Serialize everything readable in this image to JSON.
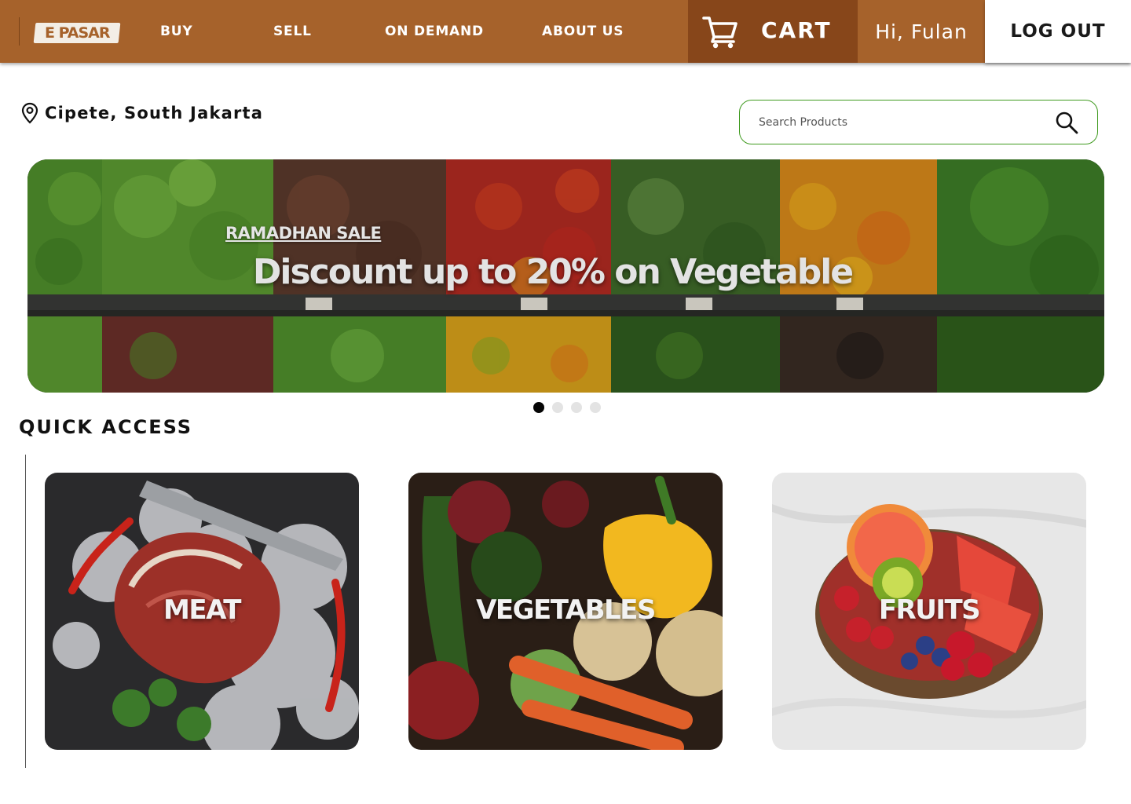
{
  "nav": {
    "logo": "E PASAR",
    "links": [
      "BUY",
      "SELL",
      "ON DEMAND",
      "ABOUT US"
    ],
    "cart_label": "CART",
    "greeting": "Hi, Fulan",
    "logout_label": "LOG OUT"
  },
  "location": {
    "label": "Cipete, South Jakarta",
    "icon": "map-pin-icon"
  },
  "search": {
    "placeholder": "Search Products",
    "value": "",
    "icon": "search-icon"
  },
  "banner": {
    "kicker": "RAMADHAN SALE",
    "headline": "Discount up to 20% on Vegetable",
    "slide_count": 4,
    "active_slide": 1
  },
  "quick_access": {
    "title": "QUICK ACCESS",
    "tiles": [
      {
        "label": "MEAT"
      },
      {
        "label": "VEGETABLES"
      },
      {
        "label": "FRUITS"
      }
    ]
  },
  "colors": {
    "nav_bg": "#a6622b",
    "cart_bg": "#87461a",
    "search_border": "#3f9a1f",
    "active_dot": "#050505",
    "inactive_dot": "#e3e3e3"
  }
}
